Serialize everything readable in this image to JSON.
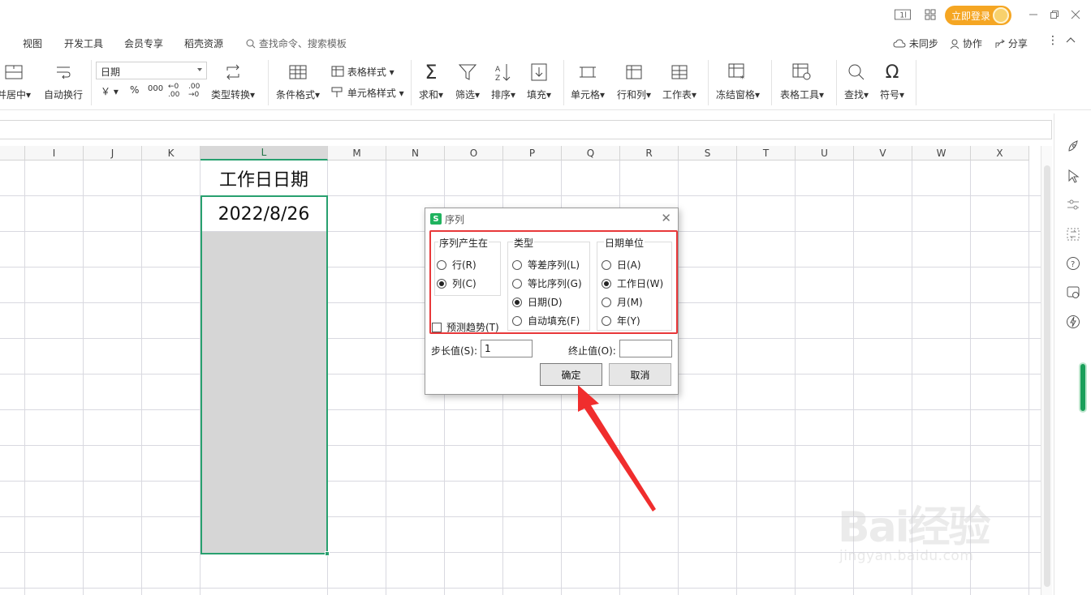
{
  "titlebar": {
    "page_indicator": "1",
    "login_label": "立即登录"
  },
  "menu": {
    "items": [
      "视图",
      "开发工具",
      "会员专享",
      "稻壳资源"
    ],
    "search_placeholder": "查找命令、搜索模板",
    "right_actions": [
      "未同步",
      "协作",
      "分享"
    ]
  },
  "ribbon": {
    "merge_center": "并居中",
    "wrap_text": "自动换行",
    "number_format": "日期",
    "currency": "￥",
    "percent": "%",
    "thousands": "000",
    "inc_decimal": "←0 .00",
    "dec_decimal": ".00 →0",
    "type_convert": "类型转换",
    "conditional_format": "条件格式",
    "table_style": "表格样式",
    "cell_style": "单元格样式",
    "sum": "求和",
    "filter": "筛选",
    "sort": "排序",
    "fill": "填充",
    "cell": "单元格",
    "row_col": "行和列",
    "worksheet": "工作表",
    "freeze": "冻结窗格",
    "table_tools": "表格工具",
    "find": "查找",
    "symbol": "符号"
  },
  "sheet": {
    "columns": [
      "I",
      "J",
      "K",
      "L",
      "M",
      "N",
      "O",
      "P",
      "Q",
      "R",
      "S",
      "T",
      "U",
      "V",
      "W",
      "X"
    ],
    "selected_column": "L",
    "header_cell": "工作日日期",
    "date_cell": "2022/8/26"
  },
  "dialog": {
    "title": "序列",
    "group_series_in": {
      "title": "序列产生在",
      "options": [
        {
          "label": "行(R)",
          "checked": false
        },
        {
          "label": "列(C)",
          "checked": true
        }
      ]
    },
    "group_type": {
      "title": "类型",
      "options": [
        {
          "label": "等差序列(L)",
          "checked": false
        },
        {
          "label": "等比序列(G)",
          "checked": false
        },
        {
          "label": "日期(D)",
          "checked": true
        },
        {
          "label": "自动填充(F)",
          "checked": false
        }
      ]
    },
    "group_date_unit": {
      "title": "日期单位",
      "options": [
        {
          "label": "日(A)",
          "checked": false
        },
        {
          "label": "工作日(W)",
          "checked": true
        },
        {
          "label": "月(M)",
          "checked": false
        },
        {
          "label": "年(Y)",
          "checked": false
        }
      ]
    },
    "trend_checkbox": "预测趋势(T)",
    "step_label": "步长值(S):",
    "step_value": "1",
    "stop_label": "终止值(O):",
    "stop_value": "",
    "ok_label": "确定",
    "cancel_label": "取消"
  },
  "watermark": {
    "brand": "Bai经验",
    "url": "jingyan.baidu.com"
  },
  "colors": {
    "accent_green": "#28a06f",
    "highlight_red": "#e8383a",
    "login_orange": "#f5a623"
  }
}
